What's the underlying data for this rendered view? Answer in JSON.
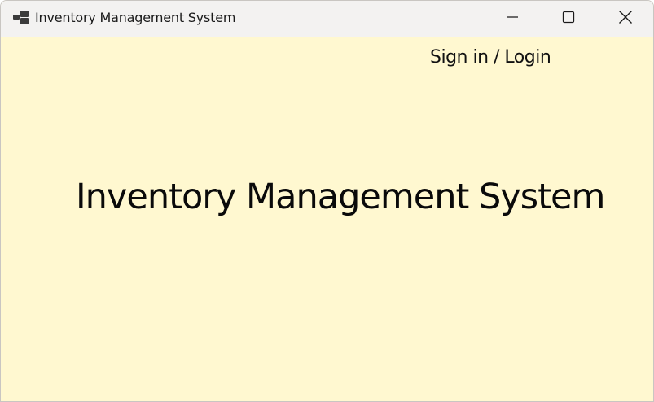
{
  "window": {
    "title": "Inventory Management System",
    "icon": "app-window-icon",
    "controls": {
      "minimize_icon": "minimize-icon",
      "maximize_icon": "maximize-icon",
      "close_icon": "close-icon"
    }
  },
  "content": {
    "signin_label": "Sign in / Login",
    "heading": "Inventory Management System"
  },
  "colors": {
    "client_background": "#fff8d0",
    "titlebar_background": "#f3f2f1",
    "text": "#111111"
  }
}
